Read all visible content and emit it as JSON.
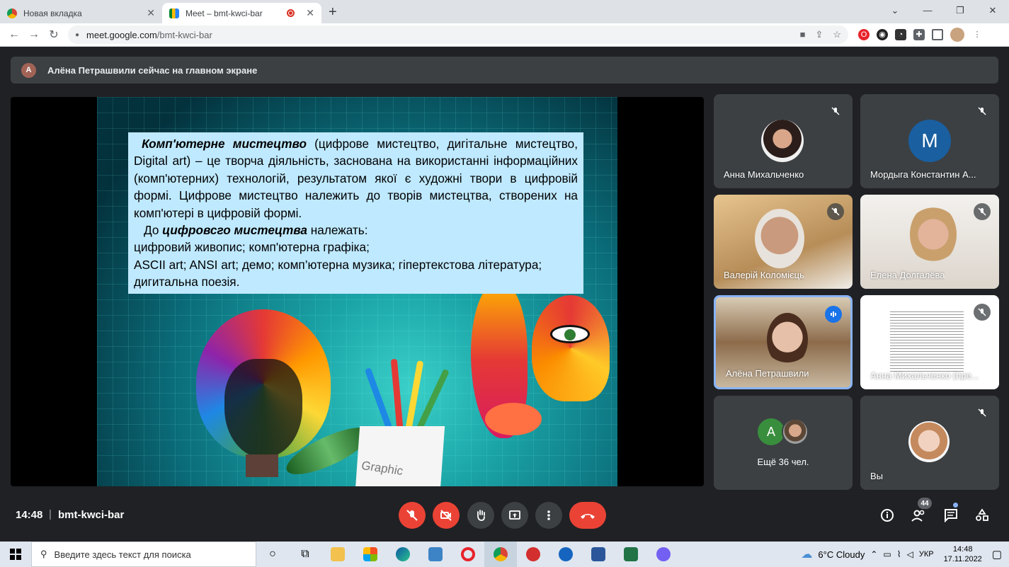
{
  "browser": {
    "tabs": [
      {
        "title": "Новая вкладка",
        "icon": "chrome-icon"
      },
      {
        "title": "Meet – bmt-kwci-bar",
        "icon": "meet-icon",
        "recording": true
      }
    ],
    "url_host": "meet.google.com",
    "url_path": "/bmt-kwci-bar"
  },
  "meet": {
    "banner_initial": "А",
    "banner_text": "Алёна Петрашвили сейчас на главном экране",
    "slide": {
      "p1_bold": "Комп'ютерне мистецтво",
      "p1_rest": " (цифрове мистецтво, дигітальне мистецтво, Digital art) – це творча діяльність, заснована на використанні інформаційних (комп'ютерних) технологій, результатом якої є художні твори в цифровій формі. Цифрове мистецтво належить до творів мистецтва, створених на комп'ютері в цифровій формі.",
      "p2_pre": "До ",
      "p2_bold": "цифровсго мистецтва",
      "p2_post": " належать:",
      "line3": "цифровий живопис; комп'ютерна графіка;",
      "line4": "ASCII art; ANSI art; демо; комп’ютерна музика; гіпертекстова література;",
      "line5": "дигитальна поезія.",
      "cup_label": "Graphic"
    },
    "participants": [
      {
        "name": "Анна Михальченко",
        "muted": true
      },
      {
        "name": "Мордыга Константин А...",
        "initial": "М",
        "color": "#1a5fa0",
        "muted": true
      },
      {
        "name": "Валерій Коломієць",
        "muted": true
      },
      {
        "name": "Елена Долгалёва",
        "muted": true
      },
      {
        "name": "Алёна Петрашвили",
        "speaking": true
      },
      {
        "name": "Анна Михальченко (пре...",
        "muted": true
      },
      {
        "more_initial": "А",
        "more_label": "Ещё 36 чел."
      },
      {
        "name": "Вы",
        "muted": true
      }
    ],
    "bottom": {
      "time": "14:48",
      "separator": "|",
      "code": "bmt-kwci-bar",
      "people_count": "44"
    }
  },
  "taskbar": {
    "search_placeholder": "Введите здесь текст для поиска",
    "weather": "6°C  Cloudy",
    "lang": "УКР",
    "clock_time": "14:48",
    "clock_date": "17.11.2022"
  }
}
